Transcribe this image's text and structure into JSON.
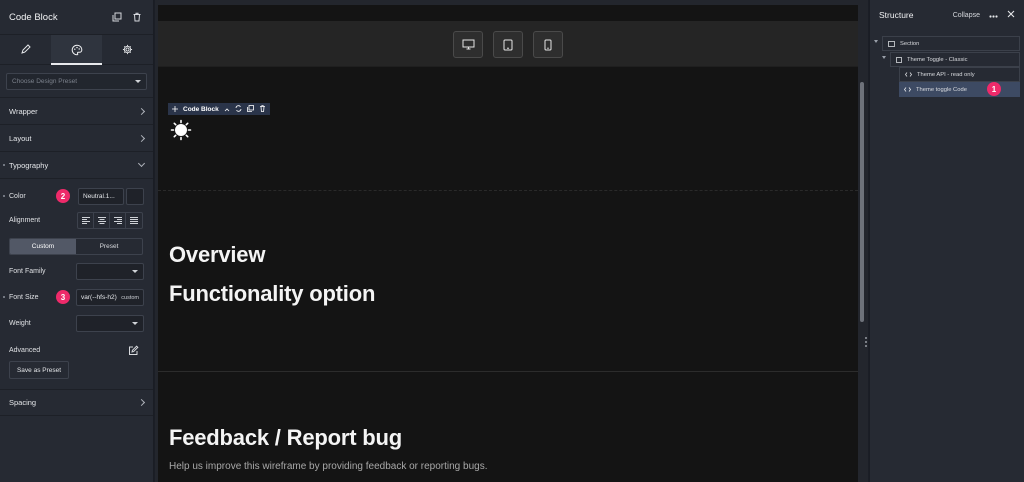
{
  "left_panel": {
    "title": "Code Block",
    "preset_placeholder": "Choose Design Preset",
    "sections": {
      "wrapper": "Wrapper",
      "layout": "Layout",
      "typography": "Typography",
      "spacing": "Spacing"
    },
    "typography": {
      "color_label": "Color",
      "color_value": "Neutral.1...",
      "alignment_label": "Alignment",
      "mode_custom": "Custom",
      "mode_preset": "Preset",
      "font_family_label": "Font Family",
      "font_size_label": "Font Size",
      "font_size_value": "var(--hfs-h2)",
      "font_size_unit": "custom",
      "weight_label": "Weight",
      "advanced_label": "Advanced",
      "save_preset": "Save as Preset"
    },
    "badges": {
      "color": "2",
      "font_size": "3"
    }
  },
  "canvas": {
    "code_block_label": "Code Block",
    "headings": {
      "overview": "Overview",
      "functionality": "Functionality option",
      "feedback": "Feedback / Report bug"
    },
    "feedback_text": "Help us improve this wireframe by providing feedback or reporting bugs."
  },
  "right_panel": {
    "title": "Structure",
    "collapse": "Collapse",
    "tree": {
      "section": "Section",
      "theme_toggle": "Theme Toggle - Classic",
      "theme_api": "Theme API - read only",
      "theme_code": "Theme toggle Code"
    },
    "badge": "1"
  },
  "colors": {
    "accent_badge": "#ee2a6a",
    "selected_row": "#3d4a63",
    "canvas_bg": "#141414"
  }
}
